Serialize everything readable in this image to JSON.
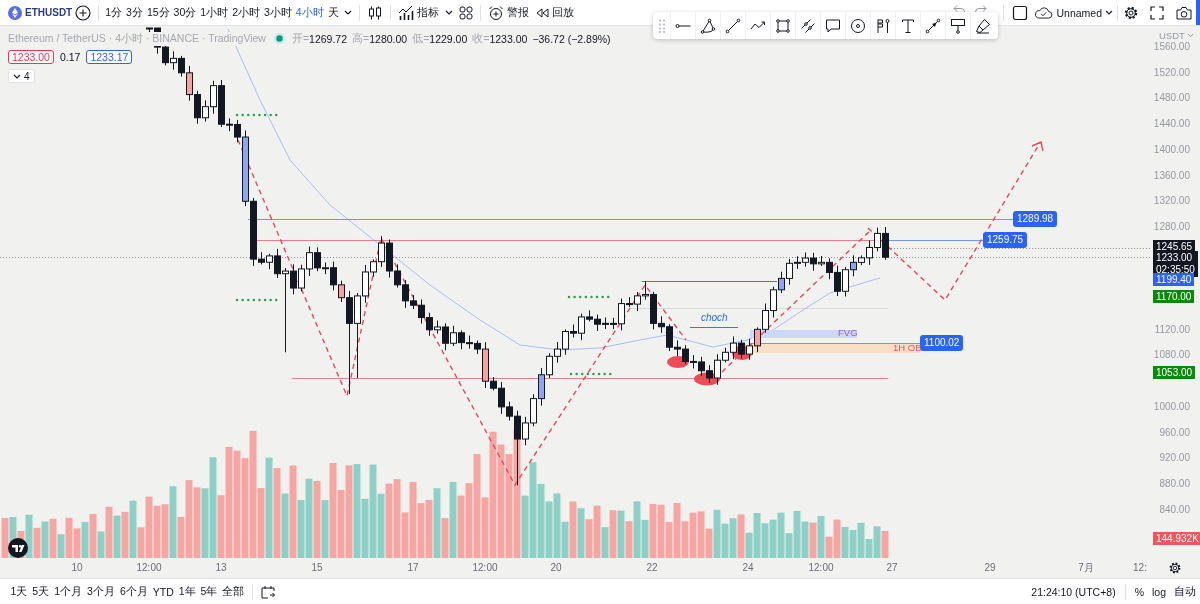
{
  "toolbar": {
    "symbol": "ETHUSDT",
    "intervals": [
      {
        "label": "1分",
        "selected": false
      },
      {
        "label": "3分",
        "selected": false
      },
      {
        "label": "15分",
        "selected": false
      },
      {
        "label": "30分",
        "selected": false
      },
      {
        "label": "1小时",
        "selected": false
      },
      {
        "label": "2小时",
        "selected": false
      },
      {
        "label": "3小时",
        "selected": false
      },
      {
        "label": "4小时",
        "selected": true
      },
      {
        "label": "天",
        "selected": false
      }
    ],
    "indicators": "指标",
    "alerts": "警报",
    "replay": "回放",
    "layout_name": "Unnamed"
  },
  "legend": {
    "title": "Ethereum / TetherUS · 4小时 · BINANCE · TradingView",
    "ohlc": [
      {
        "label": "开=",
        "value": "1269.72"
      },
      {
        "label": "高=",
        "value": "1280.00"
      },
      {
        "label": "低=",
        "value": "1229.00"
      },
      {
        "label": "收=",
        "value": "1233.00"
      }
    ],
    "change": "−36.72 (−2.89%)",
    "sell_price": "1233.00",
    "spread": "0.17",
    "buy_price": "1233.17",
    "indicator_count": "4"
  },
  "chart": {
    "level_labels": [
      "1289.98",
      "1259.75",
      "1100.02"
    ],
    "structure_label": "choch",
    "zones": [
      {
        "kind": "fvg",
        "label": "FVG"
      },
      {
        "kind": "order_block",
        "label": "1H OB"
      }
    ]
  },
  "price_axis": {
    "currency": "USDT",
    "ticks": [
      "1560.00",
      "1520.00",
      "1480.00",
      "1440.00",
      "1400.00",
      "1360.00",
      "1320.00",
      "1280.00",
      "1120.00",
      "1080.00",
      "1000.00",
      "960.00",
      "920.00",
      "880.00",
      "840.00"
    ],
    "badges": [
      {
        "text": "1245.65",
        "color": "#131722"
      },
      {
        "text": "1233.00",
        "subtext": "02:35:50",
        "color": "#131722"
      },
      {
        "text": "1199.40",
        "color": "#2962ff"
      },
      {
        "text": "1170.00",
        "color": "#0a8a0a"
      },
      {
        "text": "1053.00",
        "color": "#0a8a0a"
      },
      {
        "text": "144.932K",
        "color": "#f0575c"
      }
    ]
  },
  "time_axis": {
    "ticks": [
      "10",
      "12:00",
      "13",
      "15",
      "17",
      "12:00",
      "20",
      "22",
      "24",
      "12:00",
      "27",
      "29",
      "7月",
      "12:"
    ]
  },
  "bottom_bar": {
    "ranges": [
      "1天",
      "5天",
      "1个月",
      "3个月",
      "6个月",
      "YTD",
      "1年",
      "5年",
      "全部"
    ],
    "clock": "21:24:10 (UTC+8)",
    "scale_modes": [
      {
        "label": "%",
        "selected": false
      },
      {
        "label": "log",
        "selected": false
      },
      {
        "label": "自动",
        "selected": false
      }
    ]
  }
}
